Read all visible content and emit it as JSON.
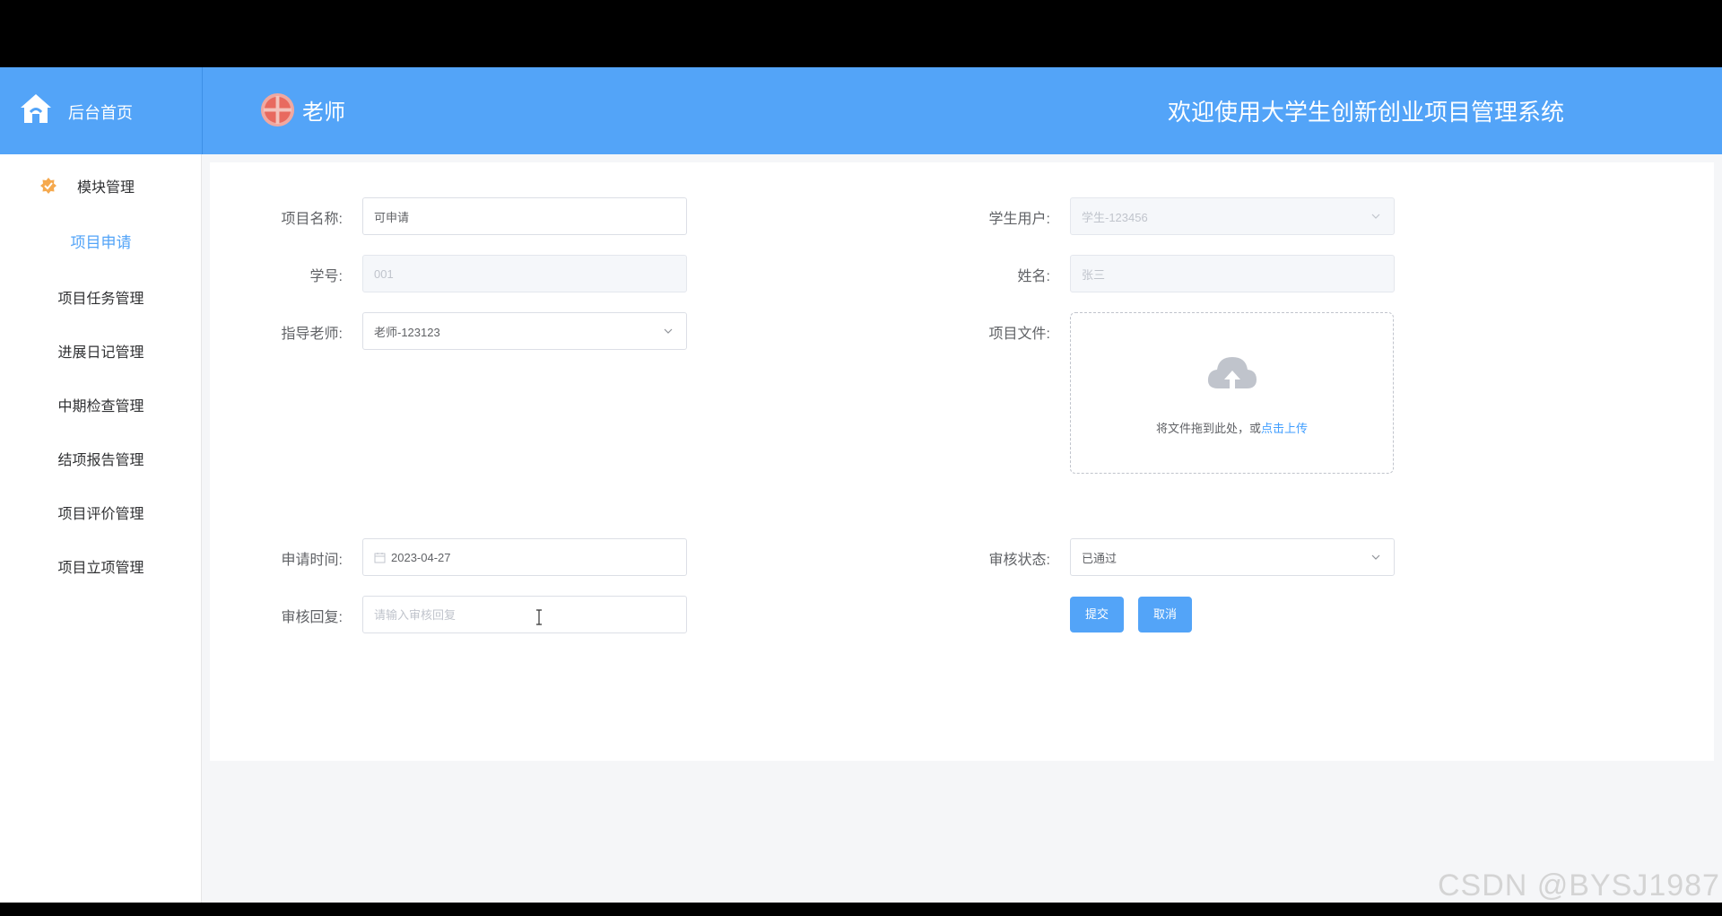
{
  "header": {
    "home_label": "后台首页",
    "role_label": "老师",
    "system_title": "欢迎使用大学生创新创业项目管理系统"
  },
  "sidebar": {
    "group_label": "模块管理",
    "items": [
      {
        "label": "项目申请",
        "active": true
      },
      {
        "label": "项目任务管理"
      },
      {
        "label": "进展日记管理"
      },
      {
        "label": "中期检查管理"
      },
      {
        "label": "结项报告管理"
      },
      {
        "label": "项目评价管理"
      },
      {
        "label": "项目立项管理"
      }
    ]
  },
  "form": {
    "project_name": {
      "label": "项目名称:",
      "value": "可申请"
    },
    "student_user": {
      "label": "学生用户:",
      "value": "学生-123456"
    },
    "student_id": {
      "label": "学号:",
      "value": "001"
    },
    "name": {
      "label": "姓名:",
      "value": "张三"
    },
    "teacher": {
      "label": "指导老师:",
      "value": "老师-123123"
    },
    "project_file": {
      "label": "项目文件:",
      "upload_text": "将文件拖到此处，或",
      "upload_link": "点击上传"
    },
    "apply_time": {
      "label": "申请时间:",
      "value": "2023-04-27"
    },
    "review_status": {
      "label": "审核状态:",
      "value": "已通过"
    },
    "review_reply": {
      "label": "审核回复:",
      "placeholder": "请输入审核回复"
    },
    "submit_label": "提交",
    "cancel_label": "取消"
  },
  "watermark": "CSDN @BYSJ1987",
  "colors": {
    "primary": "#53a4f8",
    "link": "#409eff"
  }
}
